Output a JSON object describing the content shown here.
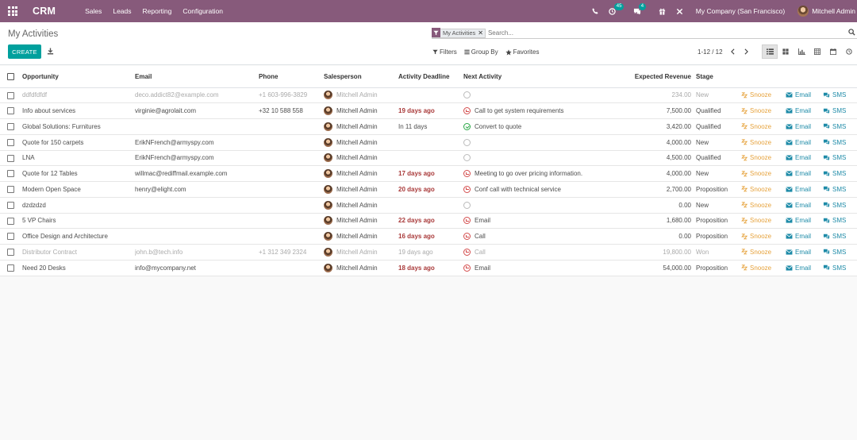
{
  "navbar": {
    "brand": "CRM",
    "menu": [
      "Sales",
      "Leads",
      "Reporting",
      "Configuration"
    ],
    "activity_count": "45",
    "message_count": "4",
    "company": "My Company (San Francisco)",
    "user": "Mitchell Admin",
    "color": "#875a7b"
  },
  "control": {
    "title": "My Activities",
    "facet": "My Activities",
    "search_placeholder": "Search...",
    "create_label": "CREATE",
    "filters_label": "Filters",
    "groupby_label": "Group By",
    "favorites_label": "Favorites",
    "pager": "1-12 / 12",
    "accent": "#00a09d"
  },
  "table": {
    "headers": [
      "Opportunity",
      "Email",
      "Phone",
      "Salesperson",
      "Activity Deadline",
      "Next Activity",
      "Expected Revenue",
      "Stage"
    ],
    "actions": {
      "snooze": "Snooze",
      "email": "Email",
      "sms": "SMS"
    },
    "rows": [
      {
        "opportunity": "ddfdfdfdf",
        "email": "deco.addict82@example.com",
        "phone": "+1 603-996-3829",
        "salesperson": "Mitchell Admin",
        "deadline": "",
        "deadline_late": false,
        "activity": "",
        "activity_state": "none",
        "revenue": "234.00",
        "stage": "New",
        "muted": true
      },
      {
        "opportunity": "Info about services",
        "email": "virginie@agrolait.com",
        "phone": "+32 10 588 558",
        "salesperson": "Mitchell Admin",
        "deadline": "19 days ago",
        "deadline_late": true,
        "activity": "Call to get system requirements",
        "activity_state": "danger",
        "revenue": "7,500.00",
        "stage": "Qualified",
        "muted": false
      },
      {
        "opportunity": "Global Solutions: Furnitures",
        "email": "",
        "phone": "",
        "salesperson": "Mitchell Admin",
        "deadline": "In 11 days",
        "deadline_late": false,
        "activity": "Convert to quote",
        "activity_state": "success",
        "revenue": "3,420.00",
        "stage": "Qualified",
        "muted": false
      },
      {
        "opportunity": "Quote for 150 carpets",
        "email": "ErikNFrench@armyspy.com",
        "phone": "",
        "salesperson": "Mitchell Admin",
        "deadline": "",
        "deadline_late": false,
        "activity": "",
        "activity_state": "none",
        "revenue": "4,000.00",
        "stage": "New",
        "muted": false
      },
      {
        "opportunity": "LNA",
        "email": "ErikNFrench@armyspy.com",
        "phone": "",
        "salesperson": "Mitchell Admin",
        "deadline": "",
        "deadline_late": false,
        "activity": "",
        "activity_state": "none",
        "revenue": "4,500.00",
        "stage": "Qualified",
        "muted": false
      },
      {
        "opportunity": "Quote for 12 Tables",
        "email": "willmac@rediffmail.example.com",
        "phone": "",
        "salesperson": "Mitchell Admin",
        "deadline": "17 days ago",
        "deadline_late": true,
        "activity": "Meeting to go over pricing information.",
        "activity_state": "danger",
        "revenue": "4,000.00",
        "stage": "New",
        "muted": false
      },
      {
        "opportunity": "Modern Open Space",
        "email": "henry@elight.com",
        "phone": "",
        "salesperson": "Mitchell Admin",
        "deadline": "20 days ago",
        "deadline_late": true,
        "activity": "Conf call with technical service",
        "activity_state": "danger",
        "revenue": "2,700.00",
        "stage": "Proposition",
        "muted": false
      },
      {
        "opportunity": "dzdzdzd",
        "email": "",
        "phone": "",
        "salesperson": "Mitchell Admin",
        "deadline": "",
        "deadline_late": false,
        "activity": "",
        "activity_state": "none",
        "revenue": "0.00",
        "stage": "New",
        "muted": false
      },
      {
        "opportunity": "5 VP Chairs",
        "email": "",
        "phone": "",
        "salesperson": "Mitchell Admin",
        "deadline": "22 days ago",
        "deadline_late": true,
        "activity": "Email",
        "activity_state": "danger",
        "revenue": "1,680.00",
        "stage": "Proposition",
        "muted": false
      },
      {
        "opportunity": "Office Design and Architecture",
        "email": "",
        "phone": "",
        "salesperson": "Mitchell Admin",
        "deadline": "16 days ago",
        "deadline_late": true,
        "activity": "Call",
        "activity_state": "danger",
        "revenue": "0.00",
        "stage": "Proposition",
        "muted": false
      },
      {
        "opportunity": "Distributor Contract",
        "email": "john.b@tech.info",
        "phone": "+1 312 349 2324",
        "salesperson": "Mitchell Admin",
        "deadline": "19 days ago",
        "deadline_late": true,
        "activity": "Call",
        "activity_state": "danger",
        "revenue": "19,800.00",
        "stage": "Won",
        "muted": true
      },
      {
        "opportunity": "Need 20 Desks",
        "email": "info@mycompany.net",
        "phone": "",
        "salesperson": "Mitchell Admin",
        "deadline": "18 days ago",
        "deadline_late": true,
        "activity": "Email",
        "activity_state": "danger",
        "revenue": "54,000.00",
        "stage": "Proposition",
        "muted": false
      }
    ]
  }
}
